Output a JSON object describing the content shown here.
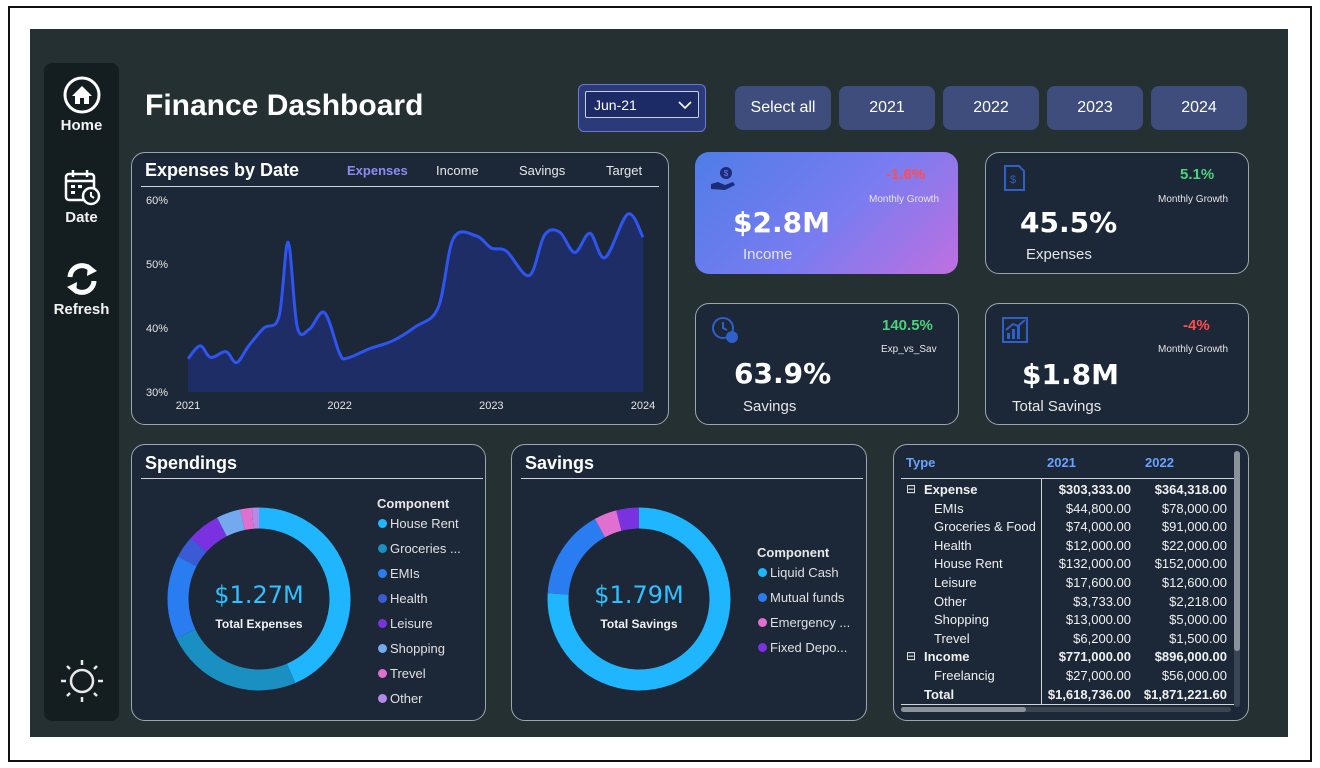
{
  "title": "Finance Dashboard",
  "sidebar": {
    "items": [
      {
        "label": "Home"
      },
      {
        "label": "Date"
      },
      {
        "label": "Refresh"
      }
    ]
  },
  "date_filter": {
    "value": "Jun-21"
  },
  "year_filter": {
    "buttons": [
      {
        "label": "Select all"
      },
      {
        "label": "2021"
      },
      {
        "label": "2022"
      },
      {
        "label": "2023"
      },
      {
        "label": "2024"
      }
    ]
  },
  "expenses_chart": {
    "title": "Expenses by Date",
    "tabs": [
      "Expenses",
      "Income",
      "Savings",
      "Target"
    ],
    "active_tab": "Expenses",
    "line_color": "#2f55f0",
    "area_color": "#1f2d66"
  },
  "kpis": {
    "income": {
      "value": "$2.8M",
      "label": "Income",
      "growth": "-1.6%",
      "note": "Monthly Growth",
      "growth_color": "#ff4d4d"
    },
    "expenses": {
      "value": "45.5%",
      "label": "Expenses",
      "growth": "5.1%",
      "note": "Monthly Growth",
      "growth_color": "#4cd27c"
    },
    "savings": {
      "value": "63.9%",
      "label": "Savings",
      "growth": "140.5%",
      "note": "Exp_vs_Sav",
      "growth_color": "#4cd27c"
    },
    "total_savings": {
      "value": "$1.8M",
      "label": "Total Savings",
      "growth": "-4%",
      "note": "Monthly Growth",
      "growth_color": "#ff4d4d"
    }
  },
  "spendings": {
    "title": "Spendings",
    "center_value": "$1.27M",
    "center_label": "Total Expenses",
    "legend_title": "Component",
    "legend": [
      {
        "label": "House Rent",
        "color": "#1fb6ff"
      },
      {
        "label": "Groceries ...",
        "color": "#1a8fc2"
      },
      {
        "label": "EMIs",
        "color": "#2a7df0"
      },
      {
        "label": "Health",
        "color": "#3b5bd6"
      },
      {
        "label": "Leisure",
        "color": "#7a32e0"
      },
      {
        "label": "Shopping",
        "color": "#74a9f0"
      },
      {
        "label": "Trevel",
        "color": "#e070d0"
      },
      {
        "label": "Other",
        "color": "#b48ae6"
      }
    ]
  },
  "savings_panel": {
    "title": "Savings",
    "center_value": "$1.79M",
    "center_label": "Total Savings",
    "legend_title": "Component",
    "legend": [
      {
        "label": "Liquid Cash",
        "color": "#1fb6ff"
      },
      {
        "label": "Mutual funds",
        "color": "#2a7df0"
      },
      {
        "label": "Emergency ...",
        "color": "#e070d0"
      },
      {
        "label": "Fixed Depo...",
        "color": "#7a32e0"
      }
    ]
  },
  "matrix": {
    "headers": [
      "Type",
      "2021",
      "2022"
    ],
    "rows": [
      {
        "label": "Expense",
        "v2021": "$303,333.00",
        "v2022": "$364,318.00",
        "level": 0,
        "bold": true,
        "toggle": "⊟"
      },
      {
        "label": "EMIs",
        "v2021": "$44,800.00",
        "v2022": "$78,000.00",
        "level": 1
      },
      {
        "label": "Groceries & Food",
        "v2021": "$74,000.00",
        "v2022": "$91,000.00",
        "level": 1
      },
      {
        "label": "Health",
        "v2021": "$12,000.00",
        "v2022": "$22,000.00",
        "level": 1
      },
      {
        "label": "House Rent",
        "v2021": "$132,000.00",
        "v2022": "$152,000.00",
        "level": 1
      },
      {
        "label": "Leisure",
        "v2021": "$17,600.00",
        "v2022": "$12,600.00",
        "level": 1
      },
      {
        "label": "Other",
        "v2021": "$3,733.00",
        "v2022": "$2,218.00",
        "level": 1
      },
      {
        "label": "Shopping",
        "v2021": "$13,000.00",
        "v2022": "$5,000.00",
        "level": 1
      },
      {
        "label": "Trevel",
        "v2021": "$6,200.00",
        "v2022": "$1,500.00",
        "level": 1
      },
      {
        "label": "Income",
        "v2021": "$771,000.00",
        "v2022": "$896,000.00",
        "level": 0,
        "bold": true,
        "toggle": "⊟"
      },
      {
        "label": "Freelancig",
        "v2021": "$27,000.00",
        "v2022": "$56,000.00",
        "level": 1
      },
      {
        "label": "Total",
        "v2021": "$1,618,736.00",
        "v2022": "$1,871,221.60",
        "level": 0,
        "bold": true
      }
    ]
  },
  "chart_data": [
    {
      "type": "area",
      "title": "Expenses by Date",
      "x_tick_labels": [
        "2021",
        "2022",
        "2023",
        "2024"
      ],
      "y_tick_labels": [
        "60%",
        "50%",
        "40%",
        "30%"
      ],
      "ylim": [
        30,
        60
      ],
      "xlim": [
        2021.0,
        2024.0
      ],
      "grid": false,
      "series": [
        {
          "x": [
            2021.0,
            2021.08,
            2021.15,
            2021.25,
            2021.32,
            2021.4,
            2021.5,
            2021.6,
            2021.66,
            2021.72,
            2021.8,
            2021.9,
            2022.0,
            2022.05,
            2022.2,
            2022.35,
            2022.5,
            2022.65,
            2022.75,
            2022.9,
            2023.0,
            2023.1,
            2023.25,
            2023.35,
            2023.45,
            2023.55,
            2023.65,
            2023.75,
            2023.9,
            2024.0
          ],
          "y": [
            35.2,
            37.2,
            35.4,
            36.3,
            34.6,
            37.2,
            40.0,
            41.8,
            53.4,
            40.2,
            39.8,
            42.4,
            36.0,
            35.3,
            36.8,
            38.0,
            40.2,
            43.2,
            54.0,
            54.4,
            52.5,
            52.0,
            48.2,
            54.5,
            55.0,
            51.8,
            54.8,
            51.0,
            57.8,
            54.2
          ]
        }
      ]
    },
    {
      "type": "pie",
      "title": "Spendings",
      "categories": [
        "House Rent",
        "Groceries & Food",
        "EMIs",
        "Health",
        "Leisure",
        "Shopping",
        "Trevel",
        "Other"
      ],
      "values": [
        132000,
        74000,
        44800,
        12000,
        17600,
        13000,
        6200,
        3733
      ]
    },
    {
      "type": "pie",
      "title": "Savings",
      "categories": [
        "Liquid Cash",
        "Mutual funds",
        "Emergency ...",
        "Fixed Depo..."
      ],
      "values": [
        76,
        16,
        4,
        4
      ]
    }
  ]
}
